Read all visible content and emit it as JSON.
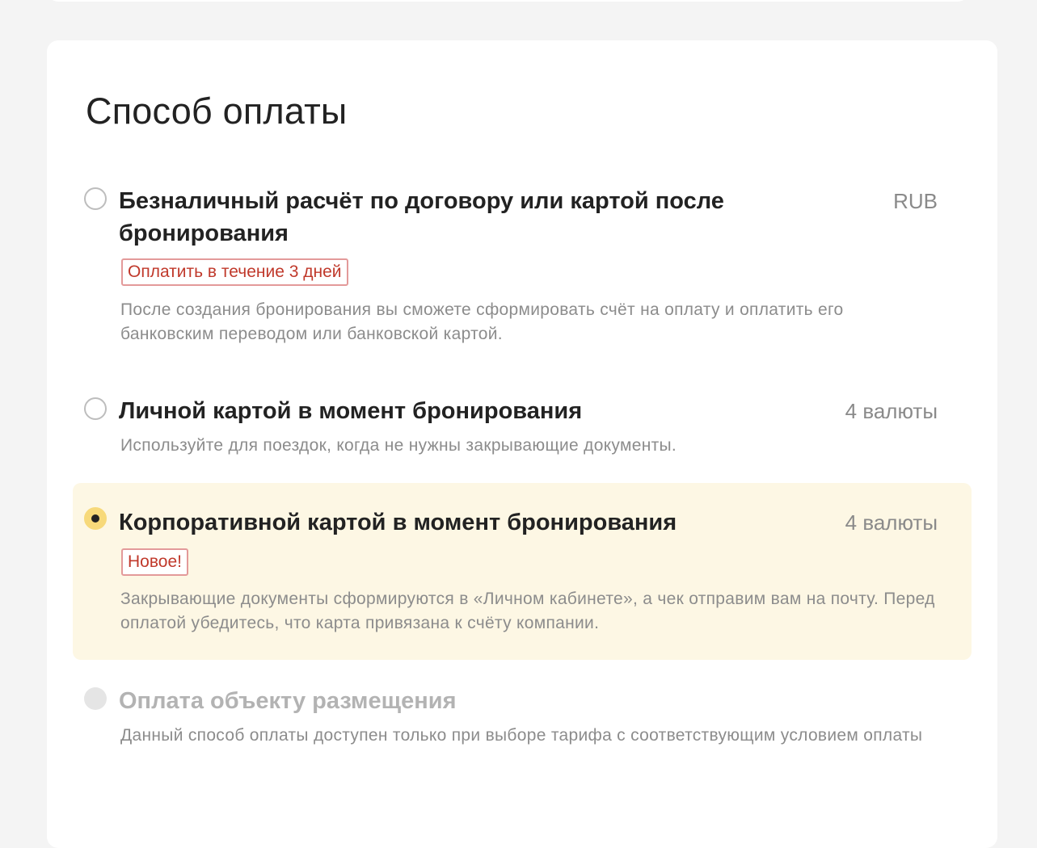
{
  "section": {
    "title": "Способ оплаты"
  },
  "options": [
    {
      "title": "Безналичный расчёт по договору или картой после бронирования",
      "currency": "RUB",
      "badge": "Оплатить в течение 3 дней",
      "description": "После создания бронирования вы сможете сформировать счёт на оплату и оплатить его банковским переводом или банковской картой.",
      "state": "unselected"
    },
    {
      "title": "Личной картой в момент бронирования",
      "currency": "4 валюты",
      "description": "Используйте для поездок, когда не нужны закрывающие документы.",
      "state": "unselected"
    },
    {
      "title": "Корпоративной картой в момент бронирования",
      "currency": "4 валюты",
      "badge": "Новое!",
      "description": "Закрывающие документы сформируются в «Личном кабинете», а чек отправим вам на почту. Перед оплатой убедитесь, что карта привязана к счёту компании.",
      "state": "selected"
    },
    {
      "title": "Оплата объекту размещения",
      "description": "Данный способ оплаты доступен только при выборе тарифа с соответствующим условием оплаты",
      "state": "disabled"
    }
  ],
  "colors": {
    "selected_background": "#fdf7e4",
    "radio_selected": "#f7d97a",
    "badge_text": "#c0392b",
    "badge_border": "#e39a9a",
    "muted_text": "#8c8c8c"
  }
}
